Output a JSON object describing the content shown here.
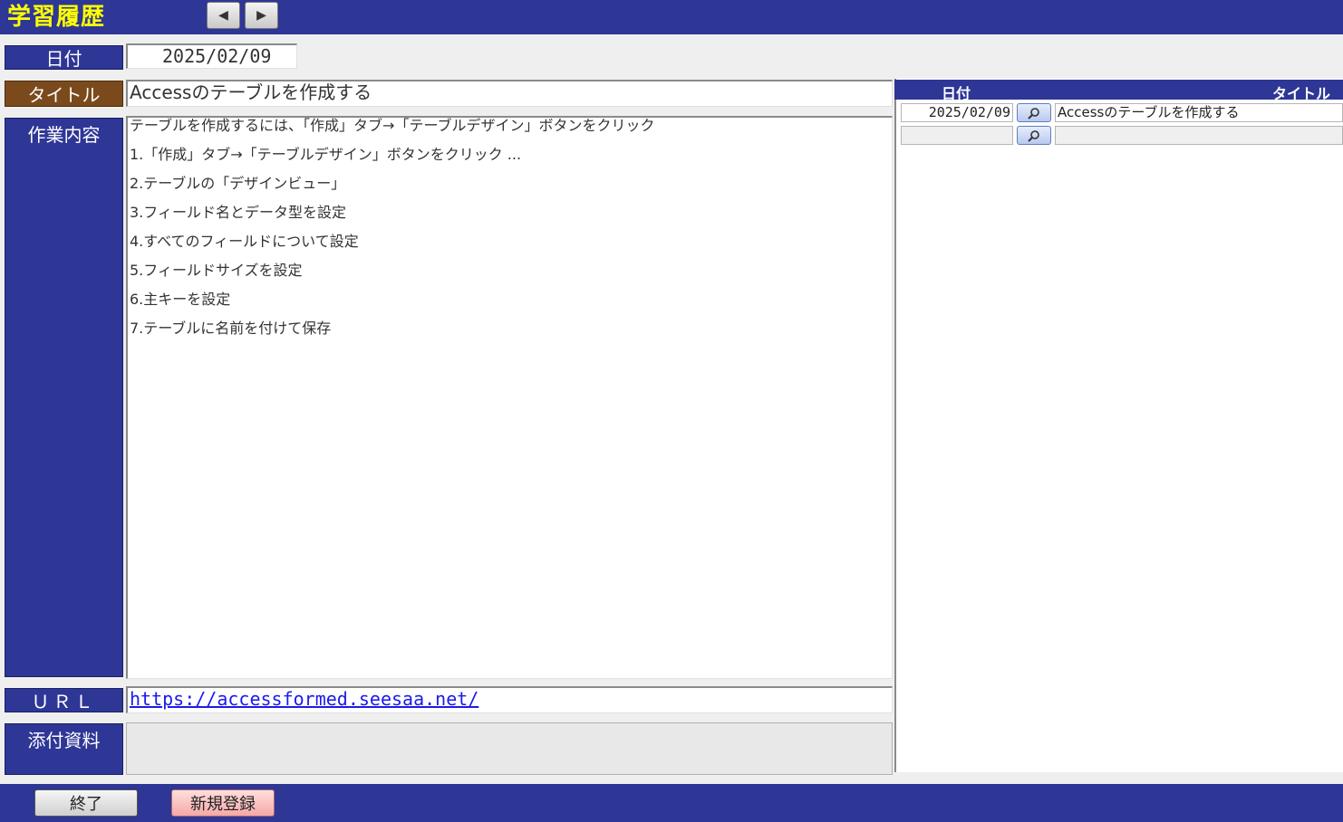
{
  "header": {
    "title": "学習履歴",
    "prev_icon": "◀",
    "next_icon": "▶"
  },
  "form": {
    "date_label": "日付",
    "date_value": "2025/02/09",
    "title_label": "タイトル",
    "title_value": "Accessのテーブルを作成する",
    "content_label": "作業内容",
    "content_lines": [
      "テーブルを作成するには、「作成」タブ→「テーブルデザイン」ボタンをクリック",
      "1.「作成」タブ→「テーブルデザイン」ボタンをクリック ...",
      "2.テーブルの「デザインビュー」",
      "3.フィールド名とデータ型を設定",
      "4.すべてのフィールドについて設定",
      "5.フィールドサイズを設定",
      "6.主キーを設定",
      "7.テーブルに名前を付けて保存"
    ],
    "url_label": "ＵＲＬ",
    "url_value": "https://accessformed.seesaa.net/",
    "attach_label": "添付資料"
  },
  "list": {
    "header_date": "日付",
    "header_title": "タイトル",
    "rows": [
      {
        "date": "2025/02/09",
        "title": "Accessのテーブルを作成する"
      },
      {
        "date": "",
        "title": ""
      }
    ]
  },
  "footer": {
    "exit_label": "終了",
    "new_label": "新規登録"
  },
  "colors": {
    "navy": "#2e3696",
    "title_label_brown": "#7b4a1c",
    "app_title_yellow": "#ffff00",
    "new_button_pink": "#f5a8a8"
  }
}
